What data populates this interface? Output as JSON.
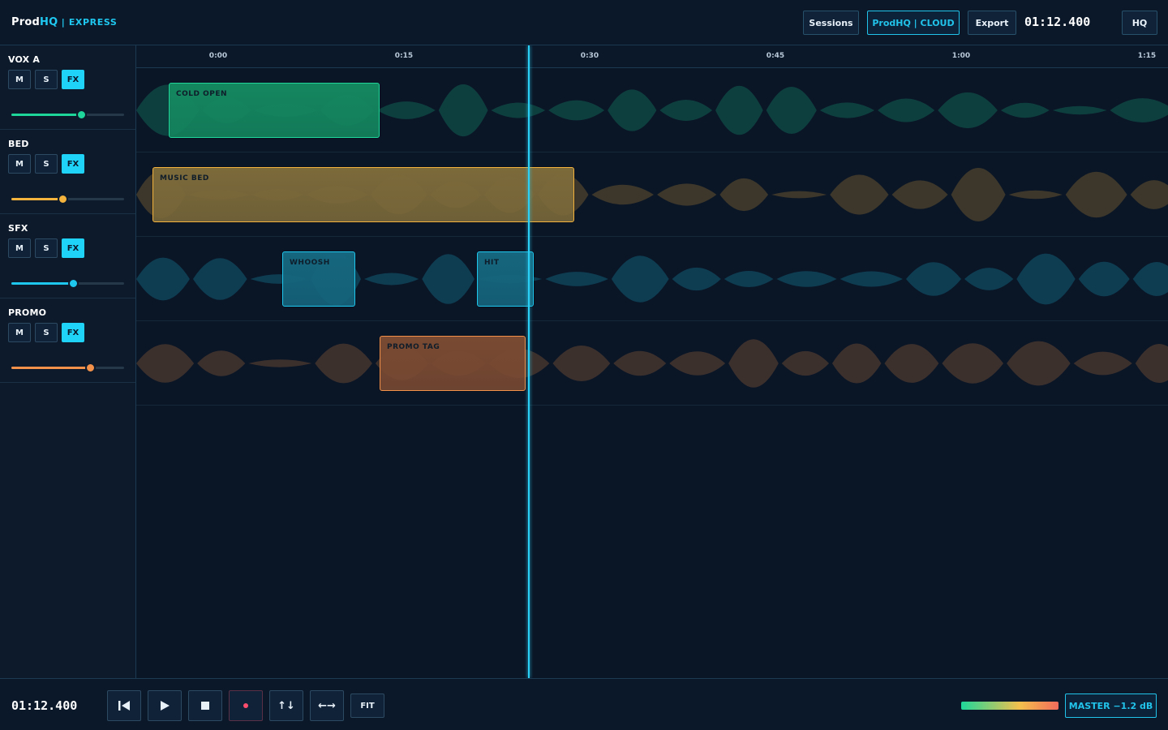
{
  "brand": {
    "name": "Prod",
    "hq": "HQ",
    "sep": " | ",
    "edition": "EXPRESS"
  },
  "header": {
    "sessions_label": "Sessions",
    "cloud_label": "ProdHQ | CLOUD",
    "export_label": "Export",
    "timecode": "01:12.400",
    "hq_label": "HQ"
  },
  "ruler": {
    "ticks": [
      "0:00",
      "0:15",
      "0:30",
      "0:45",
      "1:00",
      "1:15"
    ]
  },
  "tracks": [
    {
      "name": "VOX A",
      "mute": "M",
      "solo": "S",
      "fx": "FX",
      "color": "#1fd69a",
      "volume": 0.62
    },
    {
      "name": "BED",
      "mute": "M",
      "solo": "S",
      "fx": "FX",
      "color": "#f3b33d",
      "volume": 0.45
    },
    {
      "name": "SFX",
      "mute": "M",
      "solo": "S",
      "fx": "FX",
      "color": "#1ec7ee",
      "volume": 0.55
    },
    {
      "name": "PROMO",
      "mute": "M",
      "solo": "S",
      "fx": "FX",
      "color": "#f2914a",
      "volume": 0.7
    }
  ],
  "clips": [
    {
      "label": "COLD OPEN",
      "track": 0,
      "color": "#14875f"
    },
    {
      "label": "MUSIC BED",
      "track": 1,
      "color": "#7c6a3a"
    },
    {
      "label": "WHOOSH",
      "track": 2,
      "color": "#15667e"
    },
    {
      "label": "HIT",
      "track": 2,
      "color": "#15667e"
    },
    {
      "label": "PROMO TAG",
      "track": 3,
      "color": "#7a4a32"
    }
  ],
  "footer": {
    "timecode": "01:12.400",
    "fit_label": "FIT",
    "master_label": "MASTER −1.2 dB",
    "icons": [
      "skip-to-start-icon",
      "play-icon",
      "stop-icon",
      "record-icon",
      "vertical-zoom-icon",
      "horizontal-zoom-icon"
    ]
  },
  "colors": {
    "accent": "#1ec7ee",
    "background": "#0a1424"
  }
}
